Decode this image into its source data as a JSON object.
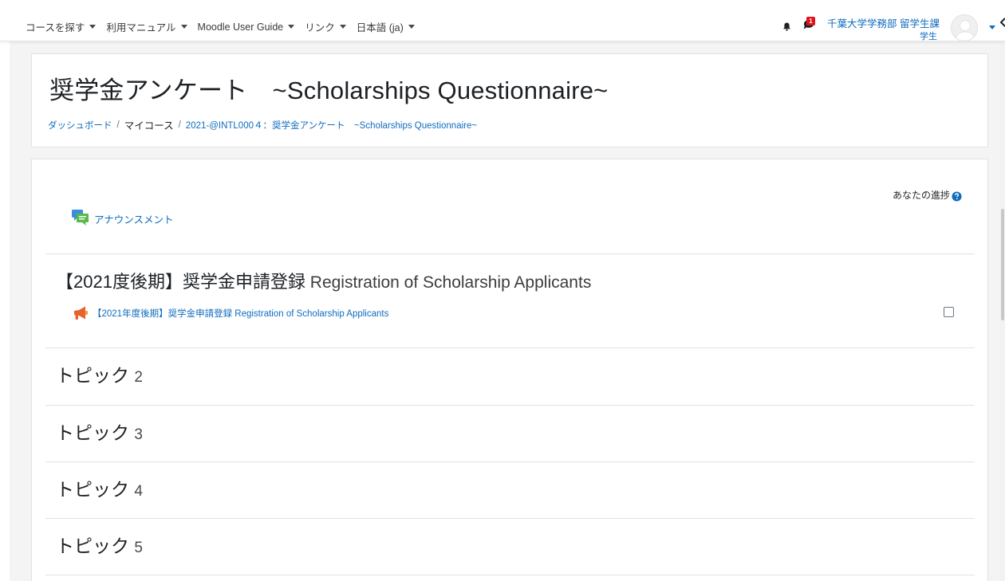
{
  "nav": {
    "items": [
      {
        "label": "コースを探す"
      },
      {
        "label": "利用マニュアル"
      },
      {
        "label": "Moodle User Guide"
      },
      {
        "label": "リンク"
      },
      {
        "label": "日本語 (ja)"
      }
    ],
    "messages_count": "1",
    "user_name": "千葉大学学務部 留学生課",
    "user_role": "学生"
  },
  "header": {
    "title": "奨学金アンケート　~Scholarships Questionnaire~",
    "breadcrumb": [
      {
        "label": "ダッシュボード"
      },
      {
        "label": "マイコース"
      },
      {
        "label": "2021-@INTL000４：奨学金アンケート　~Scholarships Questionnaire~"
      }
    ]
  },
  "course": {
    "progress_label": "あなたの進捗",
    "announcements_label": "アナウンスメント",
    "sections": [
      {
        "title": "【2021度後期】奨学金申請登録",
        "title_en": " Registration of Scholarship Applicants",
        "activity": "【2021年度後期】奨学金申請登録 Registration of Scholarship Applicants"
      },
      {
        "title": "トピック",
        "num": "2"
      },
      {
        "title": "トピック",
        "num": "3"
      },
      {
        "title": "トピック",
        "num": "4"
      },
      {
        "title": "トピック",
        "num": "5"
      }
    ]
  },
  "colors": {
    "link": "#0f6cbf",
    "badge": "#e0111b",
    "text": "#1d2125",
    "border": "#dee2e6"
  },
  "icons": [
    "bell-icon",
    "messages-icon",
    "avatar-icon",
    "chevron-down-icon",
    "help-icon",
    "forum-icon",
    "megaphone-icon",
    "checkbox-icon"
  ]
}
